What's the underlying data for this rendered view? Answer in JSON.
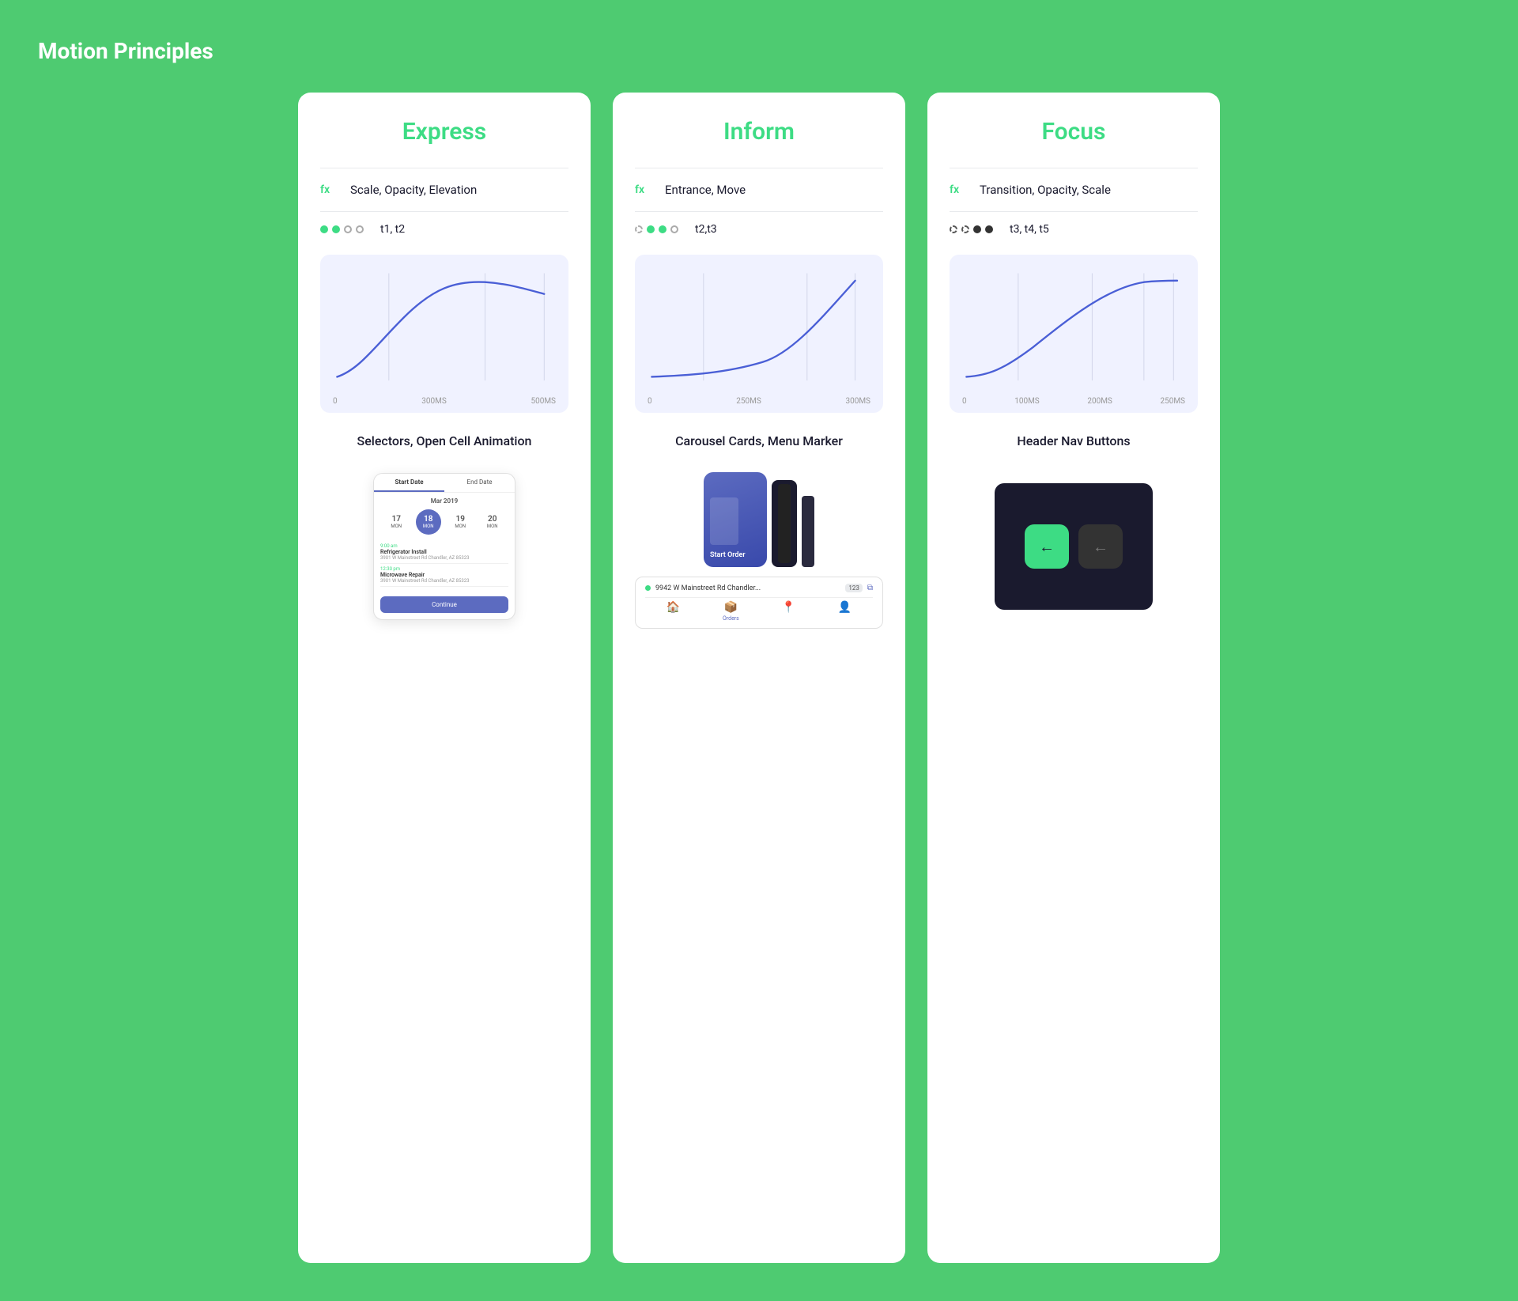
{
  "page": {
    "title": "Motion Principles",
    "background": "#4ecb71"
  },
  "cards": [
    {
      "id": "express",
      "title": "Express",
      "fx_label": "fx",
      "fx_effects": "Scale, Opacity, Elevation",
      "dots": [
        {
          "filled": true
        },
        {
          "filled": true
        },
        {
          "filled": false
        },
        {
          "filled": false
        }
      ],
      "timing": "t1, t2",
      "chart": {
        "x_labels": [
          "0",
          "300MS",
          "500MS"
        ],
        "curve_type": "ease-out-peak"
      },
      "section_label": "Selectors, Open Cell Animation",
      "preview_type": "phone"
    },
    {
      "id": "inform",
      "title": "Inform",
      "fx_label": "fx",
      "fx_effects": "Entrance, Move",
      "dots": [
        {
          "filled": false,
          "outline": true
        },
        {
          "filled": true
        },
        {
          "filled": true
        },
        {
          "filled": false
        }
      ],
      "timing": "t2,t3",
      "chart": {
        "x_labels": [
          "0",
          "250MS",
          "300MS"
        ],
        "curve_type": "ease-in-exponential"
      },
      "section_label": "Carousel Cards, Menu Marker",
      "preview_type": "carousel"
    },
    {
      "id": "focus",
      "title": "Focus",
      "fx_label": "fx",
      "fx_effects": "Transition, Opacity, Scale",
      "dots": [
        {
          "filled": false,
          "dashed": true
        },
        {
          "filled": false,
          "dashed": true
        },
        {
          "filled": true,
          "dark": true
        },
        {
          "filled": true,
          "dark": true
        }
      ],
      "timing": "t3, t4, t5",
      "chart": {
        "x_labels": [
          "0",
          "100MS",
          "200MS",
          "250MS"
        ],
        "curve_type": "ease-in-out-s"
      },
      "section_label": "Header Nav Buttons",
      "preview_type": "nav"
    }
  ],
  "phone_mockup": {
    "tab1": "Start Date",
    "tab2": "End Date",
    "month": "Mar 2019",
    "dates": [
      {
        "num": "17",
        "day": "MON"
      },
      {
        "num": "18",
        "day": "MON",
        "selected": true
      },
      {
        "num": "19",
        "day": "MON"
      },
      {
        "num": "20",
        "day": "MON"
      }
    ],
    "event1_time": "9:00 am",
    "event1_title": "Refrigerator Install",
    "event1_addr": "3901 W Mainstreet Rd Chandler, AZ 85323",
    "event2_time": "12:30 pm",
    "event2_title": "Microwave Repair",
    "event2_addr": "3901 W Mainstreet Rd Chandler, AZ 85323",
    "button": "Continue"
  },
  "carousel_mockup": {
    "card_label": "Start Order",
    "card2_label": "Orders",
    "address": "9942 W Mainstreet Rd Chandler...",
    "badge": "123",
    "nav_items": [
      {
        "icon": "🏠",
        "label": "",
        "active": false
      },
      {
        "icon": "📦",
        "label": "Orders",
        "active": true
      },
      {
        "icon": "📍",
        "label": "",
        "active": false
      },
      {
        "icon": "👤",
        "label": "",
        "active": false
      }
    ]
  },
  "nav_mockup": {
    "active_icon": "←",
    "inactive_icon": "←"
  }
}
